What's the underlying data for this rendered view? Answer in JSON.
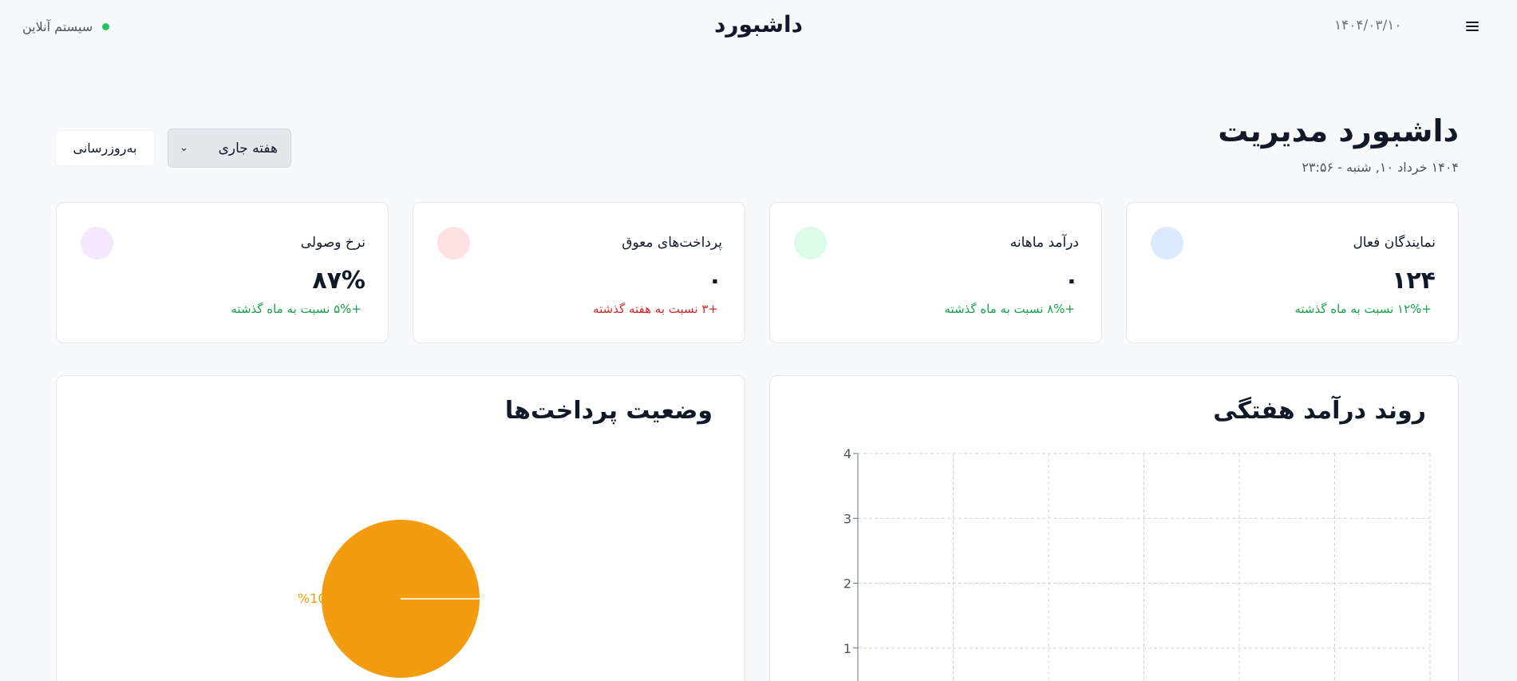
{
  "topbar": {
    "status_text": "سیستم آنلاین",
    "title": "داشبورد",
    "date": "۱۴۰۴/۰۳/۱۰",
    "status_color": "#22c55e"
  },
  "header": {
    "title": "داشبورد مدیریت",
    "subtitle": "۱۴۰۴ خرداد ۱۰, شنبه - ۲۳:۵۶"
  },
  "controls": {
    "period_value": "هفته جاری",
    "refresh_label": "به‌روزرسانی"
  },
  "stats": [
    {
      "label": "نمایندگان فعال",
      "value": "۱۲۴",
      "change": "+۱۲% نسبت به ماه گذشته",
      "change_color": "#16a34a",
      "icon_color": "#dbeafe"
    },
    {
      "label": "درآمد ماهانه",
      "value": "۰",
      "change": "+۸% نسبت به ماه گذشته",
      "change_color": "#16a34a",
      "icon_color": "#dcfce7"
    },
    {
      "label": "پرداخت‌های معوق",
      "value": "۰",
      "change": "+۳ نسبت به هفته گذشته",
      "change_color": "#dc2626",
      "icon_color": "#fee2e2"
    },
    {
      "label": "نرخ وصولی",
      "value": "۸۷%",
      "change": "+۵% نسبت به ماه گذشته",
      "change_color": "#16a34a",
      "icon_color": "#f3e8ff"
    }
  ],
  "panels": {
    "revenue_title": "روند درآمد هفتگی",
    "payments_title": "وضعیت پرداخت‌ها"
  },
  "chart_data": [
    {
      "type": "line",
      "title": "روند درآمد هفتگی",
      "ylim": [
        0,
        4
      ],
      "y_ticks": [
        "1",
        "2",
        "3",
        "4"
      ],
      "grid": true,
      "series": []
    },
    {
      "type": "pie",
      "title": "وضعیت پرداخت‌ها",
      "slices": [
        {
          "value": 100,
          "label": "%100",
          "color": "#f39c0f"
        }
      ]
    }
  ]
}
